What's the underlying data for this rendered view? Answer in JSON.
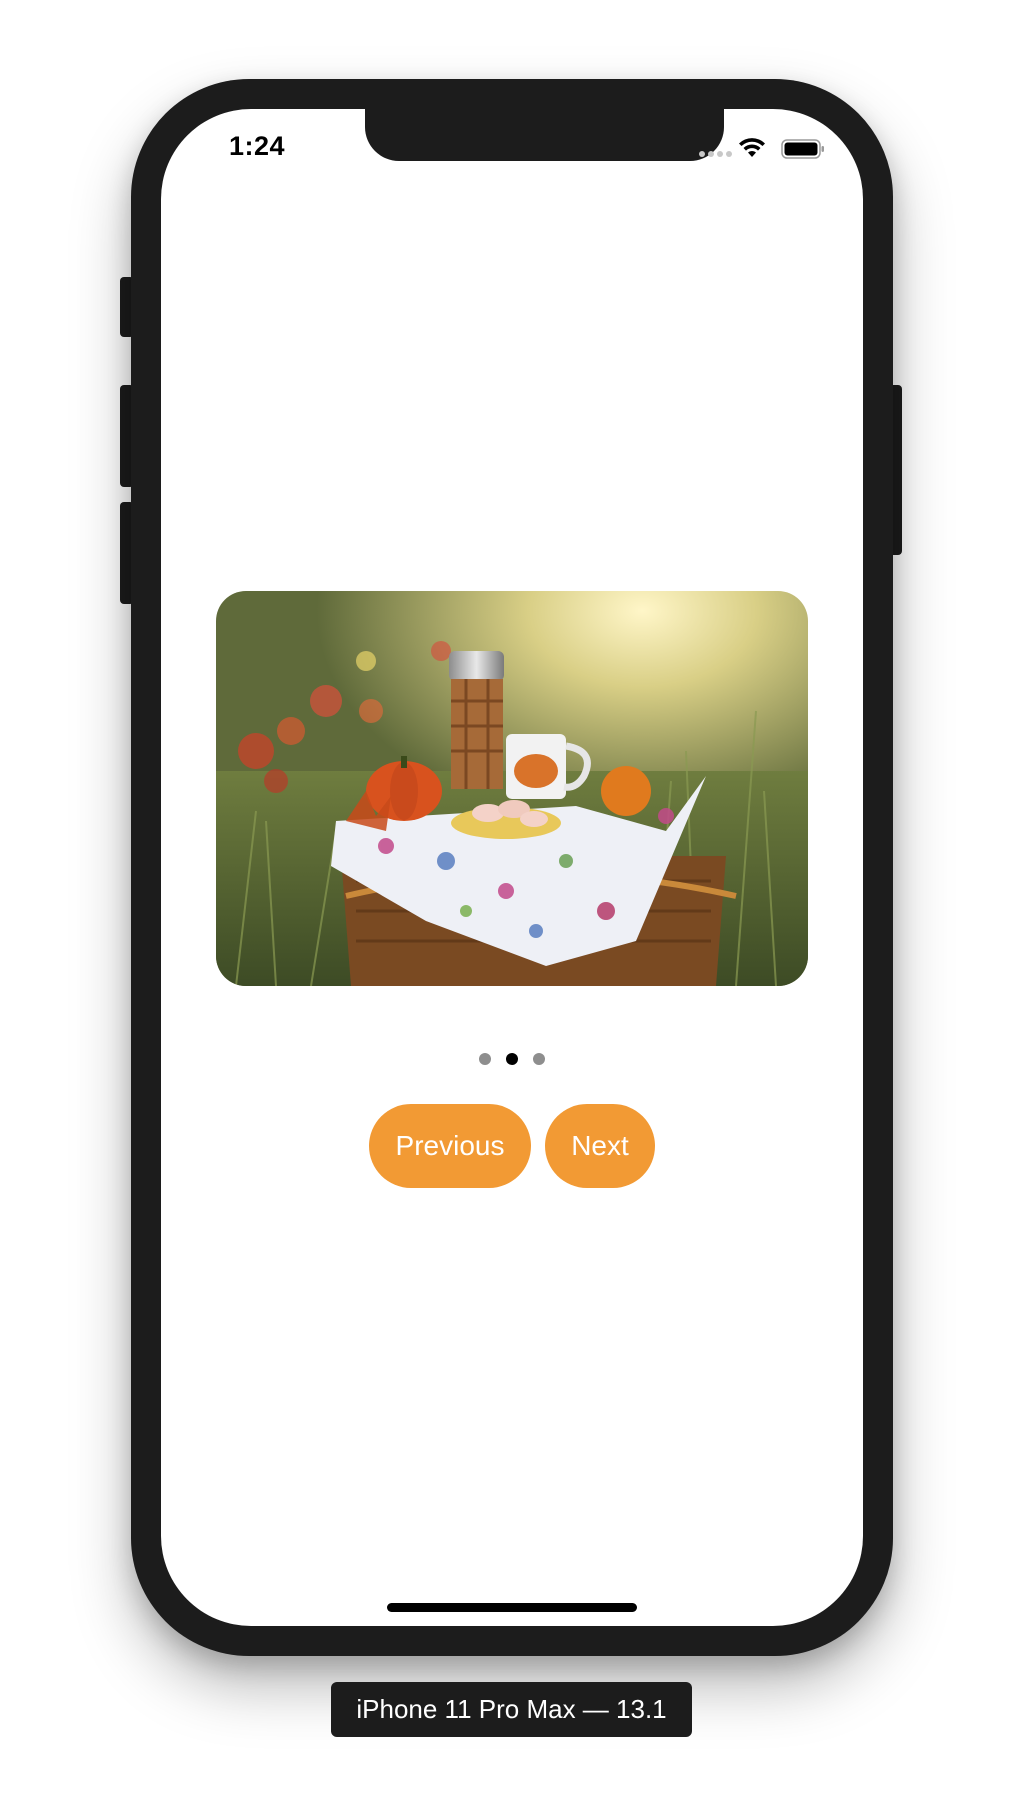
{
  "status_bar": {
    "time": "1:24",
    "icons": [
      "cellular-signal-icon",
      "wifi-icon",
      "battery-icon"
    ]
  },
  "carousel": {
    "image_description_icon": "picnic-photo",
    "page_count": 3,
    "current_page": 2
  },
  "buttons": {
    "previous_label": "Previous",
    "next_label": "Next",
    "accent_color": "#f29a34"
  },
  "device_label": "iPhone 11 Pro Max — 13.1"
}
